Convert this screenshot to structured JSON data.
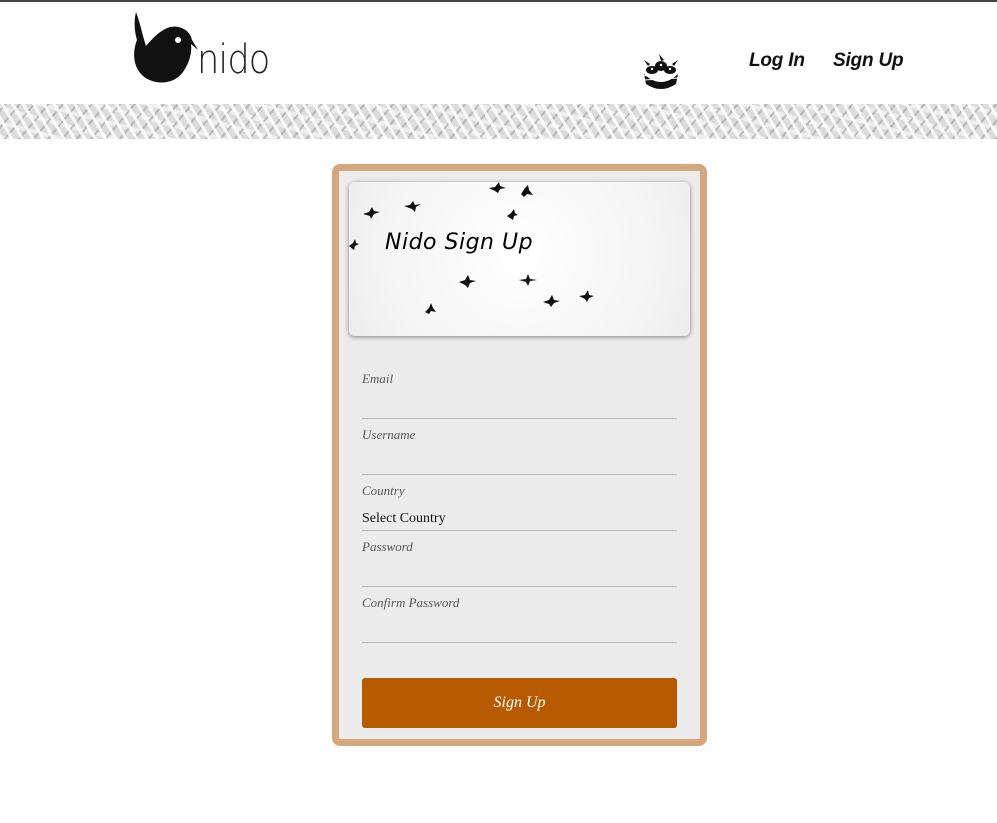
{
  "header": {
    "logo_text": "nido",
    "nav": {
      "login_label": "Log In",
      "signup_label": "Sign Up"
    }
  },
  "signup_card": {
    "title": "Nido Sign Up",
    "fields": {
      "email": {
        "label": "Email",
        "value": ""
      },
      "username": {
        "label": "Username",
        "value": ""
      },
      "country": {
        "label": "Country",
        "selected": "Select Country"
      },
      "password": {
        "label": "Password",
        "value": ""
      },
      "confirm_password": {
        "label": "Confirm Password",
        "value": ""
      }
    },
    "submit_label": "Sign Up"
  },
  "colors": {
    "card_border": "#d4a77c",
    "card_background": "#ececec",
    "submit_button": "#b85a00"
  }
}
